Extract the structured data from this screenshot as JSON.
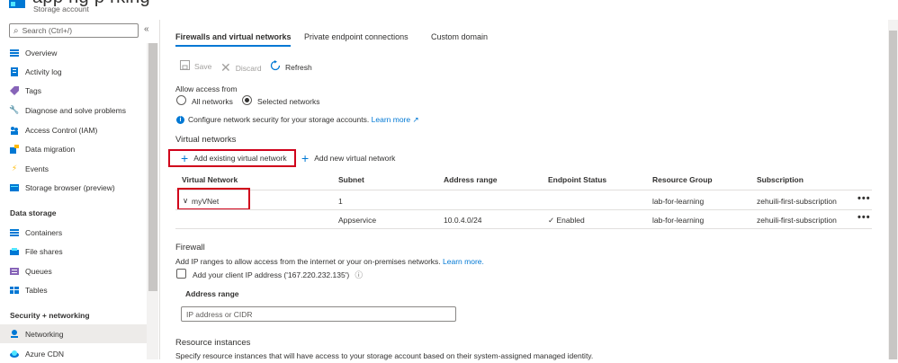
{
  "header": {
    "title": "app           ng  p   rking",
    "subtitle": "Storage account"
  },
  "nav": {
    "search_placeholder": "Search (Ctrl+/)",
    "collapse_glyph": "«",
    "items_top": [
      {
        "label": "Overview",
        "icon": "overview-icon"
      },
      {
        "label": "Activity log",
        "icon": "activity-log-icon"
      },
      {
        "label": "Tags",
        "icon": "tag-icon"
      },
      {
        "label": "Diagnose and solve problems",
        "icon": "wrench-icon"
      },
      {
        "label": "Access Control (IAM)",
        "icon": "people-icon"
      },
      {
        "label": "Data migration",
        "icon": "data-migration-icon"
      },
      {
        "label": "Events",
        "icon": "lightning-icon"
      },
      {
        "label": "Storage browser (preview)",
        "icon": "storage-browser-icon"
      }
    ],
    "section_data_storage": "Data storage",
    "items_data": [
      {
        "label": "Containers",
        "icon": "containers-icon"
      },
      {
        "label": "File shares",
        "icon": "file-shares-icon"
      },
      {
        "label": "Queues",
        "icon": "queues-icon"
      },
      {
        "label": "Tables",
        "icon": "tables-icon"
      }
    ],
    "section_security": "Security + networking",
    "items_security": [
      {
        "label": "Networking",
        "icon": "networking-icon"
      },
      {
        "label": "Azure CDN",
        "icon": "cdn-icon"
      }
    ]
  },
  "tabs": [
    "Firewalls and virtual networks",
    "Private endpoint connections",
    "Custom domain"
  ],
  "toolbar": {
    "save": "Save",
    "discard": "Discard",
    "refresh": "Refresh"
  },
  "access": {
    "label": "Allow access from",
    "options": [
      "All networks",
      "Selected networks"
    ],
    "selected": "Selected networks",
    "info_text": "Configure network security for your storage accounts.",
    "learn_more": "Learn more"
  },
  "vnets": {
    "title": "Virtual networks",
    "add_existing": "Add existing virtual network",
    "add_new": "Add new virtual network",
    "columns": [
      "Virtual Network",
      "Subnet",
      "Address range",
      "Endpoint Status",
      "Resource Group",
      "Subscription"
    ],
    "rows": [
      {
        "vnet": "myVNet",
        "subnet": "1",
        "address": "",
        "status": "",
        "rg": "lab-for-learning",
        "sub": "zehuili-first-subscription"
      },
      {
        "vnet": "",
        "subnet": "Appservice",
        "address": "10.0.4.0/24",
        "status": "Enabled",
        "rg": "lab-for-learning",
        "sub": "zehuili-first-subscription"
      }
    ],
    "more": "•••"
  },
  "firewall": {
    "title": "Firewall",
    "desc": "Add IP ranges to allow access from the internet or your on-premises networks.",
    "learn_more": "Learn more.",
    "client_ip_label": "Add your client IP address ('167.220.232.135')",
    "address_range_label": "Address range",
    "ip_placeholder": "IP address or CIDR"
  },
  "resource_instances": {
    "title": "Resource instances",
    "desc": "Specify resource instances that will have access to your storage account based on their system-assigned managed identity."
  },
  "colors": {
    "accent": "#0078d4",
    "highlight": "#d0021b",
    "selected_nav": "#edebe9"
  }
}
